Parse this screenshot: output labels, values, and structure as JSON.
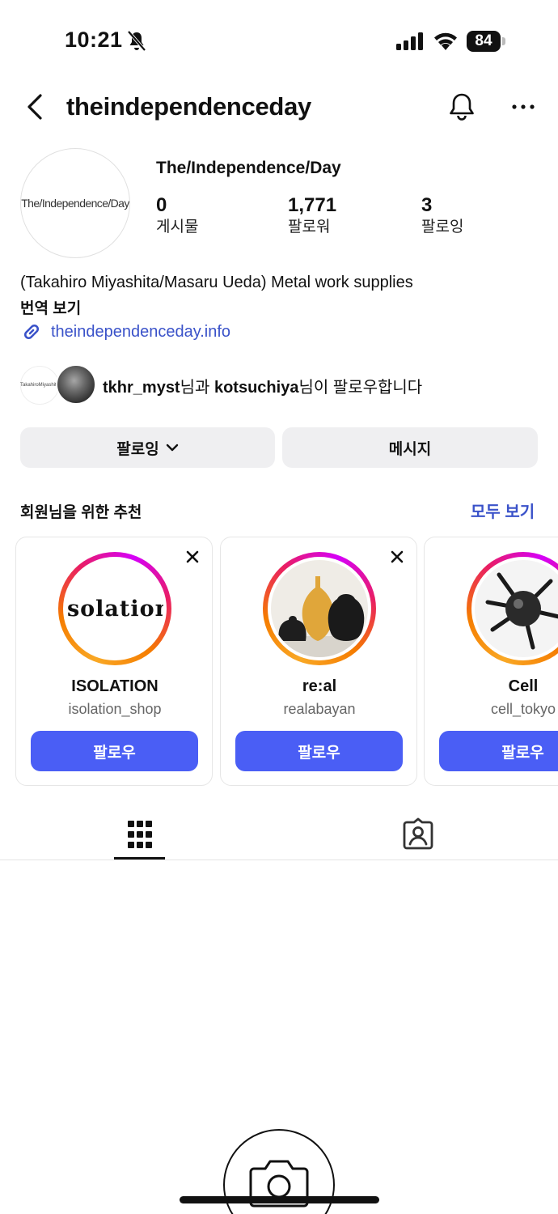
{
  "status_bar": {
    "time": "10:21",
    "battery": "84"
  },
  "header": {
    "username": "theindependenceday"
  },
  "profile": {
    "avatar_text": "The/Independence/Day",
    "display_name": "The/Independence/Day",
    "stats": {
      "posts": {
        "value": "0",
        "label": "게시물"
      },
      "followers": {
        "value": "1,771",
        "label": "팔로워"
      },
      "following": {
        "value": "3",
        "label": "팔로잉"
      }
    },
    "bio": "(Takahiro Miyashita/Masaru Ueda) Metal work supplies",
    "translate_label": "번역 보기",
    "link": "theindependenceday.info"
  },
  "mutual": {
    "avatar1_text": "TakahiroMiyashita",
    "user1": "tkhr_myst",
    "text1": "님과 ",
    "user2": "kotsuchiya",
    "text2": "님이 팔로우합니다"
  },
  "actions": {
    "following_label": "팔로잉",
    "message_label": "메시지"
  },
  "suggestions": {
    "title": "회원님을 위한 추천",
    "see_all": "모두 보기",
    "cards": [
      {
        "name": "ISOLATION",
        "handle": "isolation_shop",
        "logo_text": "isolation",
        "follow": "팔로우"
      },
      {
        "name": "re:al",
        "handle": "realabayan",
        "follow": "팔로우"
      },
      {
        "name": "Cell",
        "handle": "cell_tokyo",
        "follow": "팔로우"
      }
    ]
  },
  "colors": {
    "accent_blue": "#4a5ef5",
    "link_blue": "#3a52c9",
    "button_gray": "#efeff1"
  }
}
